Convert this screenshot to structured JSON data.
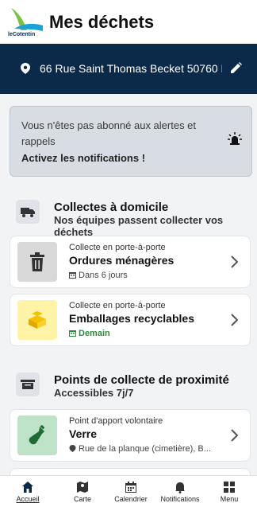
{
  "header": {
    "title": "Mes déchets",
    "logo_text": "leCotentin"
  },
  "address": {
    "text": "66 Rue Saint Thomas Becket 50760 B..."
  },
  "notification_banner": {
    "line1": "Vous n'êtes pas abonné aux alertes et",
    "line2": "rappels",
    "cta": "Activez les notifications !"
  },
  "home_collection": {
    "title": "Collectes à domicile",
    "subtitle": "Nos équipes passent collecter vos déchets",
    "items": [
      {
        "kind": "Collecte en porte-à-porte",
        "title": "Ordures ménagères",
        "when": "Dans 6 jours",
        "thumb_color": "#d9d9d9"
      },
      {
        "kind": "Collecte en porte-à-porte",
        "title": "Emballages recyclables",
        "when": "Demain",
        "thumb_color": "#fff3a8"
      }
    ]
  },
  "proximity": {
    "title": "Points de collecte de proximité",
    "subtitle": "Accessibles 7j/7",
    "items": [
      {
        "kind": "Point d'apport volontaire",
        "title": "Verre",
        "location": "Rue de la planque (cimetière), B...",
        "thumb_color": "#bfe3c8"
      }
    ]
  },
  "tabs": [
    {
      "label": "Accueil",
      "icon": "home-icon",
      "active": true
    },
    {
      "label": "Carte",
      "icon": "map-icon"
    },
    {
      "label": "Calendrier",
      "icon": "calendar-icon"
    },
    {
      "label": "Notifications",
      "icon": "bell-icon"
    },
    {
      "label": "Menu",
      "icon": "grid-icon"
    }
  ],
  "colors": {
    "navy": "#0b2a4a",
    "green": "#2e8b3a",
    "logo_green": "#7cc242",
    "logo_blue": "#1aa3d9"
  }
}
